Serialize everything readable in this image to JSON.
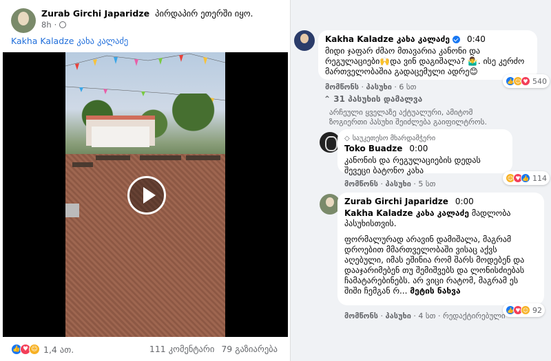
{
  "post": {
    "author": "Zurab Girchi Japaridze",
    "status": "პირდაპირ ეთერში იყო.",
    "time": "8h",
    "mention": "Kakha Kaladze კახა კალაძე",
    "reaction_count": "1,4 ათ.",
    "comments_count": "111 კომენტარი",
    "shares_count": "79 გაზიარება"
  },
  "comments": [
    {
      "name": "Kakha Kaladze კახა კალაძე",
      "time": "0:40",
      "text": "მიდი ჯაფარ ძმაო მთავარია კანონი და რეგულაციები🙌და ვინ დაგიშალა? 🤷‍♂️. ისე კერძო მართველობაშია გადაცემული ადრე😊",
      "like": "მომწონს",
      "reply": "პასუხი",
      "age": "6 სთ",
      "reactions": "540"
    },
    {
      "hidden_replies": "31 პასუხის დამალვა",
      "filter_note": "არჩეული ყველაზე აქტუალური, ამიტომ ზოგიერთი პასუხი შეიძლება გაიფილტროს."
    },
    {
      "badge": "საუკეთესო მხარდამჭერი",
      "name": "Toko Buadze",
      "time": "0:00",
      "text": "კანონის და რეგულაციების დედას შევეცი ბატონო კახა",
      "like": "მომწონს",
      "reply": "პასუხი",
      "age": "5 სთ",
      "reactions": "114"
    },
    {
      "name": "Zurab Girchi Japaridze",
      "time": "0:00",
      "mention": "Kakha Kaladze კახა კალაძე",
      "text1": "მადლობა პასუხისთვის.",
      "text2": "ფორმალურად არავინ დამიშალა, მაგრამ დროებით მმართველობაში ვისაც აქვს აღებული, იმას ეშინია რომ შარს მოდებენ და დააჯარიმებენ თუ შემიშვებს და ლონისძიებას ჩამატარებინებს. არ ვიცი რატომ, მაგრამ ეს შიში ჩემგან რ...",
      "see_more": "მეტის ნახვა",
      "like": "მომწონს",
      "reply": "პასუხი",
      "age": "4 სთ",
      "edited": "რედაქტირებული",
      "reactions": "92"
    }
  ]
}
